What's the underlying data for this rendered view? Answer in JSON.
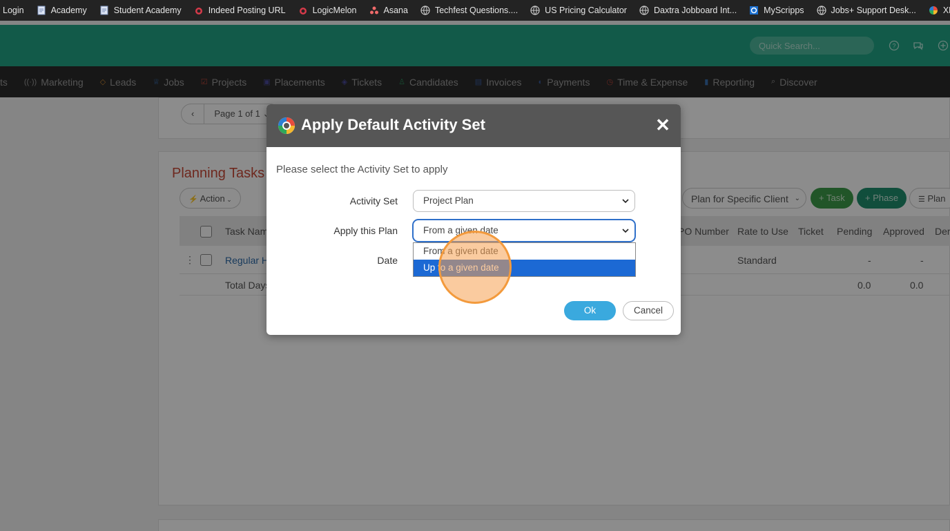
{
  "bookmarks": [
    {
      "label": "Login",
      "icon": "none"
    },
    {
      "label": "Academy",
      "icon": "document-icon"
    },
    {
      "label": "Student Academy",
      "icon": "document-icon"
    },
    {
      "label": "Indeed Posting URL",
      "icon": "logicmelon-icon"
    },
    {
      "label": "LogicMelon",
      "icon": "logicmelon-icon"
    },
    {
      "label": "Asana",
      "icon": "asana-icon"
    },
    {
      "label": "Techfest Questions....",
      "icon": "globe-icon"
    },
    {
      "label": "US Pricing Calculator",
      "icon": "globe-icon"
    },
    {
      "label": "Daxtra Jobboard Int...",
      "icon": "globe-icon"
    },
    {
      "label": "MyScripps",
      "icon": "myscripps-icon"
    },
    {
      "label": "Jobs+ Support Desk...",
      "icon": "globe-icon"
    },
    {
      "label": "XML FEED",
      "icon": "colorful-logo-icon"
    }
  ],
  "header": {
    "search_placeholder": "Quick Search...",
    "brand_color": "#21a586"
  },
  "nav": [
    {
      "label": "ts",
      "icon": ""
    },
    {
      "label": "Marketing",
      "icon": "antenna-icon",
      "color": "#9a9a9a"
    },
    {
      "label": "Leads",
      "icon": "diamond-icon",
      "color": "#c9832f"
    },
    {
      "label": "Jobs",
      "icon": "trophy-icon",
      "color": "#3a6fb0"
    },
    {
      "label": "Projects",
      "icon": "checkbox-icon",
      "color": "#b8453a"
    },
    {
      "label": "Placements",
      "icon": "briefcase-icon",
      "color": "#4a4a9a"
    },
    {
      "label": "Tickets",
      "icon": "tag-icon",
      "color": "#4a4a9a"
    },
    {
      "label": "Candidates",
      "icon": "person-icon",
      "color": "#2a8a5a"
    },
    {
      "label": "Invoices",
      "icon": "invoice-icon",
      "color": "#3a5a9a"
    },
    {
      "label": "Payments",
      "icon": "payment-icon",
      "color": "#3a5a9a"
    },
    {
      "label": "Time & Expense",
      "icon": "clock-icon",
      "color": "#b8453a"
    },
    {
      "label": "Reporting",
      "icon": "bar-chart-icon",
      "color": "#3a6fb0"
    },
    {
      "label": "Discover",
      "icon": "search-icon",
      "color": "#9a9a9a"
    }
  ],
  "pager": {
    "prev": "‹",
    "page_label": "Page 1 of 1 ⌄"
  },
  "section": {
    "title": "Planning Tasks",
    "action_label": "Action",
    "plan_select": "Plan for Specific Client",
    "task_btn": "+ Task",
    "phase_btn": "+ Phase",
    "plan_btn": "Plan"
  },
  "table": {
    "headers": [
      "Task Nam",
      "PO Number",
      "Rate to Use",
      "Ticket",
      "Pending",
      "Approved",
      "Der"
    ],
    "row": {
      "task": "Regular H",
      "rate": "Standard",
      "pending": "-",
      "approved": "-"
    },
    "total": {
      "label": "Total Days",
      "pending": "0.0",
      "approved": "0.0"
    }
  },
  "modal": {
    "title": "Apply Default Activity Set",
    "subtitle": "Please select the Activity Set to apply",
    "close": "✕",
    "fields": {
      "activity_set_label": "Activity Set",
      "activity_set_value": "Project Plan",
      "apply_plan_label": "Apply this Plan",
      "apply_plan_value": "From a given date",
      "date_label": "Date"
    },
    "dropdown_options": [
      "From a given date",
      "Up to a given date"
    ],
    "selected_index": 1,
    "ok": "Ok",
    "cancel": "Cancel"
  }
}
